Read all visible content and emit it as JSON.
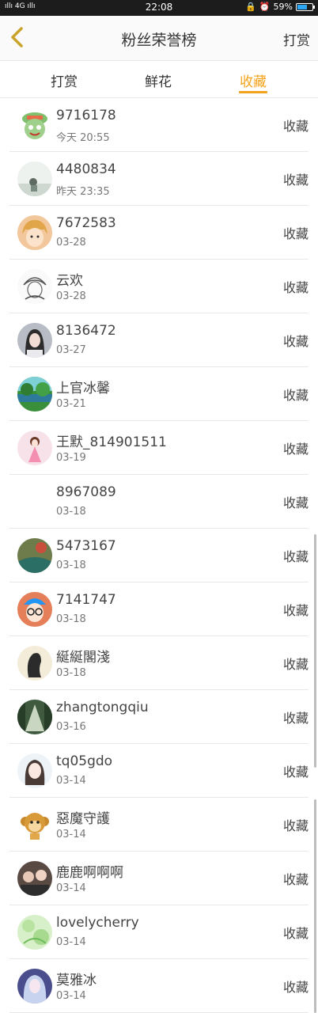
{
  "status_bar": {
    "signal": "4G",
    "time": "22:08",
    "battery": "59%",
    "battery_level": 0.59
  },
  "header": {
    "title": "粉丝荣誉榜",
    "action": "打赏"
  },
  "tabs": [
    {
      "label": "打赏",
      "active": false
    },
    {
      "label": "鲜花",
      "active": false
    },
    {
      "label": "收藏",
      "active": true
    }
  ],
  "colors": {
    "accent": "#f5a21b",
    "back_icon": "#d39f1f"
  },
  "rows": [
    {
      "name": "9716178",
      "date": "今天 20:55",
      "action": "收藏",
      "avatar": "frog-cartoon-avatar"
    },
    {
      "name": "4480834",
      "date": "昨天 23:35",
      "action": "收藏",
      "avatar": "photo-avatar"
    },
    {
      "name": "7672583",
      "date": "03-28",
      "action": "收藏",
      "avatar": "anime-avatar"
    },
    {
      "name": "云欢",
      "date": "03-28",
      "action": "收藏",
      "avatar": "sketch-avatar"
    },
    {
      "name": "8136472",
      "date": "03-27",
      "action": "收藏",
      "avatar": "girl-photo-avatar"
    },
    {
      "name": "上官冰馨",
      "date": "03-21",
      "action": "收藏",
      "avatar": "landscape-avatar"
    },
    {
      "name": "王默_814901511",
      "date": "03-19",
      "action": "收藏",
      "avatar": "pink-anime-avatar"
    },
    {
      "name": "8967089",
      "date": "03-18",
      "action": "收藏",
      "avatar": "blank-avatar"
    },
    {
      "name": "5473167",
      "date": "03-18",
      "action": "收藏",
      "avatar": "nature-avatar"
    },
    {
      "name": "7141747",
      "date": "03-18",
      "action": "收藏",
      "avatar": "glasses-boy-avatar"
    },
    {
      "name": "綖綖閣淺",
      "date": "03-18",
      "action": "收藏",
      "avatar": "silhouette-avatar"
    },
    {
      "name": "zhangtongqiu",
      "date": "03-16",
      "action": "收藏",
      "avatar": "forest-avatar"
    },
    {
      "name": "tq05gdo",
      "date": "03-14",
      "action": "收藏",
      "avatar": "woman-avatar"
    },
    {
      "name": "惡魔守護",
      "date": "03-14",
      "action": "收藏",
      "avatar": "monkey-avatar"
    },
    {
      "name": "鹿鹿啊啊啊",
      "date": "03-14",
      "action": "收藏",
      "avatar": "couple-avatar"
    },
    {
      "name": "lovelycherry",
      "date": "03-14",
      "action": "收藏",
      "avatar": "green-avatar"
    },
    {
      "name": "莫雅冰",
      "date": "03-14",
      "action": "收藏",
      "avatar": "fantasy-avatar"
    }
  ]
}
